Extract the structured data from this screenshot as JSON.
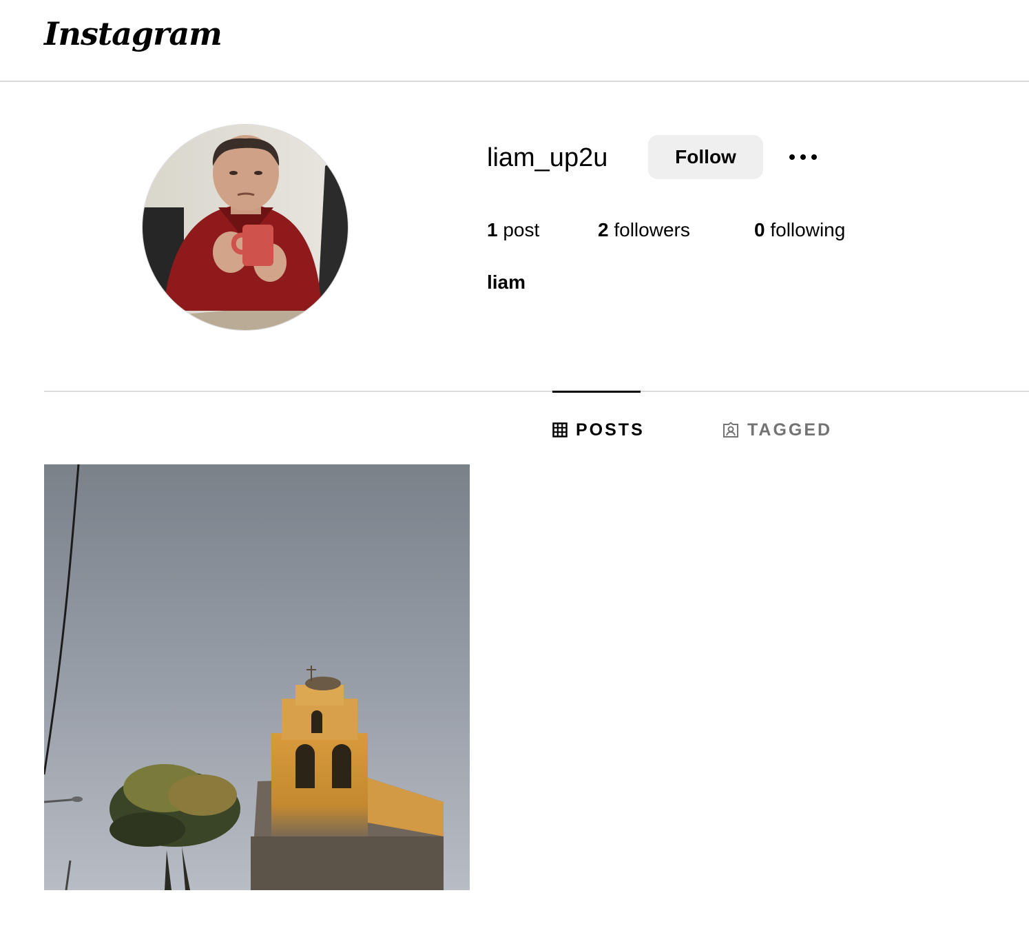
{
  "header": {
    "logo_text": "Instagram"
  },
  "profile": {
    "username": "liam_up2u",
    "follow_label": "Follow",
    "more_icon": "more-horizontal-icon",
    "stats": {
      "posts_count": "1",
      "posts_label": "post",
      "followers_count": "2",
      "followers_label": "followers",
      "following_count": "0",
      "following_label": "following"
    },
    "full_name": "liam"
  },
  "tabs": [
    {
      "label": "POSTS",
      "icon": "grid-icon",
      "active": true
    },
    {
      "label": "TAGGED",
      "icon": "tagged-user-icon",
      "active": false
    }
  ],
  "posts": [
    {
      "alt": "church bell tower at sunset"
    }
  ],
  "colors": {
    "divider": "#dbdbdb",
    "button_bg": "#efefef",
    "inactive_tab": "#737373"
  }
}
